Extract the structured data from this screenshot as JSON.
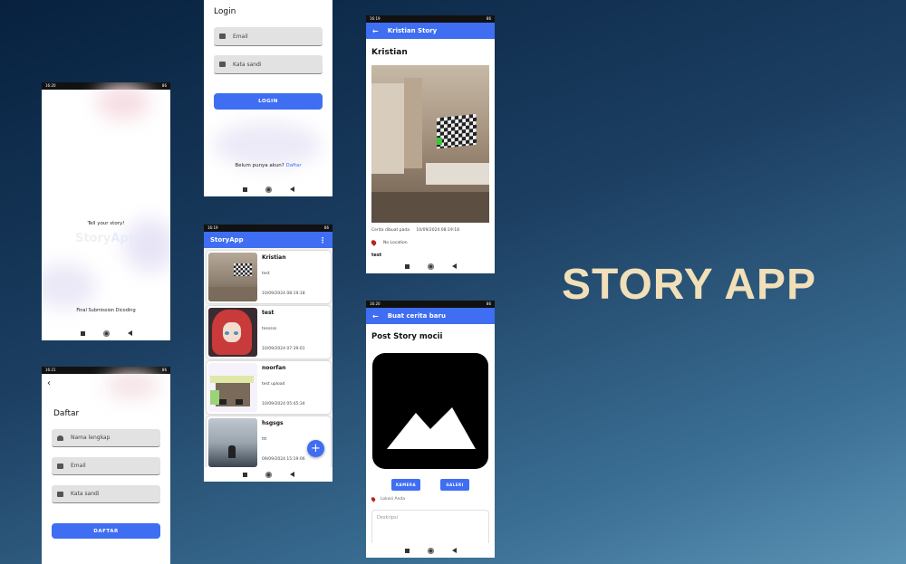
{
  "status": {
    "splash_time": "16:20",
    "login_time": "",
    "detail_time": "16:19",
    "list_time": "16:19",
    "register_time": "16:21",
    "post_time": "16:20",
    "icons": "𝕏 P ◀ P",
    "battery": "86"
  },
  "splash": {
    "tagline": "Tell your story!",
    "app_name_part1": "Story",
    "app_name_part2": "App",
    "footer": "Final Submission Dicoding"
  },
  "login": {
    "title": "Login",
    "email_placeholder": "Email",
    "password_placeholder": "Kata sandi",
    "button": "LOGIN",
    "no_account": "Belum punya akun?",
    "register_link": "Daftar"
  },
  "register": {
    "title": "Daftar",
    "name_placeholder": "Nama lengkap",
    "email_placeholder": "Email",
    "password_placeholder": "Kata sandi",
    "button": "DAFTAR"
  },
  "story_list": {
    "app_title": "StoryApp",
    "menu_icon": "more-vert-icon",
    "stories": [
      {
        "name": "Kristian",
        "description": "test",
        "date": "10/09/2024 08:19:18"
      },
      {
        "name": "test",
        "description": "tesssss",
        "date": "10/09/2024 07:39:01"
      },
      {
        "name": "noorfan",
        "description": "test upload",
        "date": "10/09/2024 05:45:34"
      },
      {
        "name": "hsgsgs",
        "description": "ttt",
        "date": "09/09/2024 15:19:06"
      }
    ],
    "fab": "+"
  },
  "detail": {
    "appbar_title": "Kristian Story",
    "name": "Kristian",
    "created_label": "Cerita dibuat pada",
    "created_date": "10/09/2024 08:19:18",
    "location": "No Location",
    "description": "test"
  },
  "post": {
    "appbar_title": "Buat cerita baru",
    "heading": "Post Story mocii",
    "camera_button": "KAMERA",
    "gallery_button": "GALERI",
    "location_label": "Lokasi Anda",
    "description_placeholder": "Deskripsi"
  },
  "headline": "STORY APP",
  "colors": {
    "accent": "#3f6ef3",
    "headline": "#f1dfb8"
  }
}
